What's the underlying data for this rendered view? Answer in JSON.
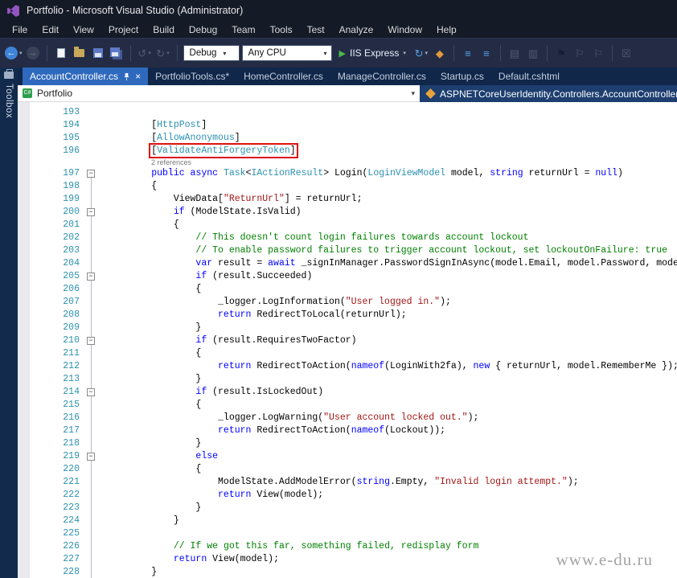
{
  "window": {
    "title": "Portfolio - Microsoft Visual Studio  (Administrator)"
  },
  "menu": {
    "items": [
      "File",
      "Edit",
      "View",
      "Project",
      "Build",
      "Debug",
      "Team",
      "Tools",
      "Test",
      "Analyze",
      "Window",
      "Help"
    ]
  },
  "toolbar": {
    "debug_config": "Debug",
    "platform": "Any CPU",
    "run_label": "IIS Express"
  },
  "tabs": [
    {
      "label": "AccountController.cs",
      "active": true
    },
    {
      "label": "PortfolioTools.cs*",
      "active": false
    },
    {
      "label": "HomeController.cs",
      "active": false
    },
    {
      "label": "ManageController.cs",
      "active": false
    },
    {
      "label": "Startup.cs",
      "active": false
    },
    {
      "label": "Default.cshtml",
      "active": false
    }
  ],
  "toolbox": {
    "label": "Toolbox"
  },
  "navbar": {
    "project": "Portfolio",
    "type_path": "ASPNETCoreUserIdentity.Controllers.AccountController"
  },
  "watermark": "www.e-du.ru",
  "colors": {
    "active_tab": "#2e69bd",
    "keyword": "#0000ff",
    "type": "#2b91af",
    "string": "#a31515",
    "comment": "#008000",
    "line_number": "#2b91af",
    "annotation_box": "#dd1111"
  },
  "code": {
    "lines": [
      {
        "n": "193",
        "seg": []
      },
      {
        "n": "194",
        "seg": [
          [
            "pl",
            "        ["
          ],
          [
            "at",
            "HttpPost"
          ],
          [
            "pl",
            "]"
          ]
        ]
      },
      {
        "n": "195",
        "seg": [
          [
            "pl",
            "        ["
          ],
          [
            "at",
            "AllowAnonymous"
          ],
          [
            "pl",
            "]"
          ]
        ]
      },
      {
        "n": "196",
        "box": true,
        "pre": "        ",
        "seg": [
          [
            "pl",
            "["
          ],
          [
            "at",
            "ValidateAntiForgeryToken"
          ],
          [
            "pl",
            "]"
          ]
        ]
      },
      {
        "lens": "2 references"
      },
      {
        "n": "197",
        "f": true,
        "seg": [
          [
            "pl",
            "        "
          ],
          [
            "kw",
            "public"
          ],
          [
            "pl",
            " "
          ],
          [
            "kw",
            "async"
          ],
          [
            "pl",
            " "
          ],
          [
            "ty",
            "Task"
          ],
          [
            "pl",
            "<"
          ],
          [
            "ty",
            "IActionResult"
          ],
          [
            "pl",
            "> Login("
          ],
          [
            "ty",
            "LoginViewModel"
          ],
          [
            "pl",
            " model, "
          ],
          [
            "kw",
            "string"
          ],
          [
            "pl",
            " returnUrl = "
          ],
          [
            "kw",
            "null"
          ],
          [
            "pl",
            ")"
          ]
        ]
      },
      {
        "n": "198",
        "g": true,
        "seg": [
          [
            "pl",
            "        {"
          ]
        ]
      },
      {
        "n": "199",
        "g": true,
        "seg": [
          [
            "pl",
            "            ViewData["
          ],
          [
            "st",
            "\"ReturnUrl\""
          ],
          [
            "pl",
            "] = returnUrl;"
          ]
        ]
      },
      {
        "n": "200",
        "f": true,
        "seg": [
          [
            "pl",
            "            "
          ],
          [
            "kw",
            "if"
          ],
          [
            "pl",
            " (ModelState.IsValid)"
          ]
        ]
      },
      {
        "n": "201",
        "g": true,
        "seg": [
          [
            "pl",
            "            {"
          ]
        ]
      },
      {
        "n": "202",
        "g": true,
        "seg": [
          [
            "pl",
            "                "
          ],
          [
            "cm",
            "// This doesn't count login failures towards account lockout"
          ]
        ]
      },
      {
        "n": "203",
        "g": true,
        "seg": [
          [
            "pl",
            "                "
          ],
          [
            "cm",
            "// To enable password failures to trigger account lockout, set lockoutOnFailure: true"
          ]
        ]
      },
      {
        "n": "204",
        "g": true,
        "seg": [
          [
            "pl",
            "                "
          ],
          [
            "kw",
            "var"
          ],
          [
            "pl",
            " result = "
          ],
          [
            "kw",
            "await"
          ],
          [
            "pl",
            " _signInManager.PasswordSignInAsync(model.Email, model.Password, model.RememberMe, lockoutOnFailure: "
          ],
          [
            "kw",
            "false"
          ],
          [
            "pl",
            ");"
          ]
        ]
      },
      {
        "n": "205",
        "f": true,
        "seg": [
          [
            "pl",
            "                "
          ],
          [
            "kw",
            "if"
          ],
          [
            "pl",
            " (result.Succeeded)"
          ]
        ]
      },
      {
        "n": "206",
        "g": true,
        "seg": [
          [
            "pl",
            "                {"
          ]
        ]
      },
      {
        "n": "207",
        "g": true,
        "seg": [
          [
            "pl",
            "                    _logger.LogInformation("
          ],
          [
            "st",
            "\"User logged in.\""
          ],
          [
            "pl",
            ");"
          ]
        ]
      },
      {
        "n": "208",
        "g": true,
        "seg": [
          [
            "pl",
            "                    "
          ],
          [
            "kw",
            "return"
          ],
          [
            "pl",
            " RedirectToLocal(returnUrl);"
          ]
        ]
      },
      {
        "n": "209",
        "g": true,
        "seg": [
          [
            "pl",
            "                }"
          ]
        ]
      },
      {
        "n": "210",
        "f": true,
        "seg": [
          [
            "pl",
            "                "
          ],
          [
            "kw",
            "if"
          ],
          [
            "pl",
            " (result.RequiresTwoFactor)"
          ]
        ]
      },
      {
        "n": "211",
        "g": true,
        "seg": [
          [
            "pl",
            "                {"
          ]
        ]
      },
      {
        "n": "212",
        "g": true,
        "seg": [
          [
            "pl",
            "                    "
          ],
          [
            "kw",
            "return"
          ],
          [
            "pl",
            " RedirectToAction("
          ],
          [
            "kw",
            "nameof"
          ],
          [
            "pl",
            "(LoginWith2fa), "
          ],
          [
            "kw",
            "new"
          ],
          [
            "pl",
            " { returnUrl, model.RememberMe });"
          ]
        ]
      },
      {
        "n": "213",
        "g": true,
        "seg": [
          [
            "pl",
            "                }"
          ]
        ]
      },
      {
        "n": "214",
        "f": true,
        "seg": [
          [
            "pl",
            "                "
          ],
          [
            "kw",
            "if"
          ],
          [
            "pl",
            " (result.IsLockedOut)"
          ]
        ]
      },
      {
        "n": "215",
        "g": true,
        "seg": [
          [
            "pl",
            "                {"
          ]
        ]
      },
      {
        "n": "216",
        "g": true,
        "seg": [
          [
            "pl",
            "                    _logger.LogWarning("
          ],
          [
            "st",
            "\"User account locked out.\""
          ],
          [
            "pl",
            ");"
          ]
        ]
      },
      {
        "n": "217",
        "g": true,
        "seg": [
          [
            "pl",
            "                    "
          ],
          [
            "kw",
            "return"
          ],
          [
            "pl",
            " RedirectToAction("
          ],
          [
            "kw",
            "nameof"
          ],
          [
            "pl",
            "(Lockout));"
          ]
        ]
      },
      {
        "n": "218",
        "g": true,
        "seg": [
          [
            "pl",
            "                }"
          ]
        ]
      },
      {
        "n": "219",
        "f": true,
        "seg": [
          [
            "pl",
            "                "
          ],
          [
            "kw",
            "else"
          ]
        ]
      },
      {
        "n": "220",
        "g": true,
        "seg": [
          [
            "pl",
            "                {"
          ]
        ]
      },
      {
        "n": "221",
        "g": true,
        "seg": [
          [
            "pl",
            "                    ModelState.AddModelError("
          ],
          [
            "kw",
            "string"
          ],
          [
            "pl",
            ".Empty, "
          ],
          [
            "st",
            "\"Invalid login attempt.\""
          ],
          [
            "pl",
            ");"
          ]
        ]
      },
      {
        "n": "222",
        "g": true,
        "seg": [
          [
            "pl",
            "                    "
          ],
          [
            "kw",
            "return"
          ],
          [
            "pl",
            " View(model);"
          ]
        ]
      },
      {
        "n": "223",
        "g": true,
        "seg": [
          [
            "pl",
            "                }"
          ]
        ]
      },
      {
        "n": "224",
        "g": true,
        "seg": [
          [
            "pl",
            "            }"
          ]
        ]
      },
      {
        "n": "225",
        "g": true,
        "seg": []
      },
      {
        "n": "226",
        "g": true,
        "seg": [
          [
            "pl",
            "            "
          ],
          [
            "cm",
            "// If we got this far, something failed, redisplay form"
          ]
        ]
      },
      {
        "n": "227",
        "g": true,
        "seg": [
          [
            "pl",
            "            "
          ],
          [
            "kw",
            "return"
          ],
          [
            "pl",
            " View(model);"
          ]
        ]
      },
      {
        "n": "228",
        "g": true,
        "seg": [
          [
            "pl",
            "        }"
          ]
        ]
      }
    ]
  }
}
